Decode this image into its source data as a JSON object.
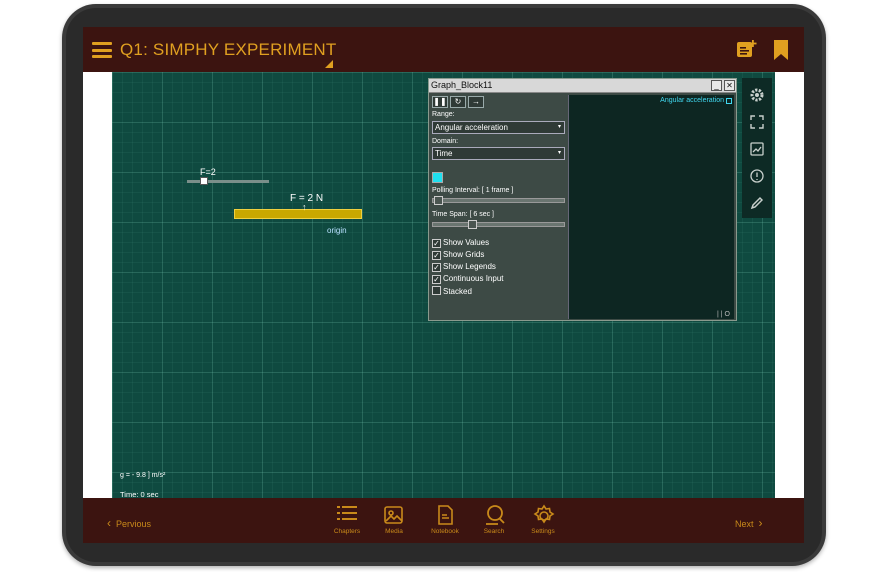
{
  "header": {
    "title": "Q1: SIMPHY EXPERIMENT"
  },
  "canvas": {
    "slider_label": "F=2",
    "force_label": "F = 2 N",
    "origin_label": "origin",
    "gravity_label": "g = - 9.8 ] m/s²",
    "time_label": "Time: 0 sec"
  },
  "graph_panel": {
    "title": "Graph_Block11",
    "range_label": "Range:",
    "range_value": "Angular acceleration",
    "domain_label": "Domain:",
    "domain_value": "Time",
    "series_color": "#20e0f0",
    "polling_label": "Polling Interval: [ 1 frame ]",
    "timespan_label": "Time Span: [ 6 sec ]",
    "checkboxes": [
      {
        "label": "Show Values",
        "checked": true
      },
      {
        "label": "Show Grids",
        "checked": true
      },
      {
        "label": "Show Legends",
        "checked": true
      },
      {
        "label": "Continuous Input",
        "checked": true
      },
      {
        "label": "Stacked",
        "checked": false
      }
    ],
    "legend": "Angular acceleration",
    "plot_footer": "| | O"
  },
  "bottom_bar": {
    "previous": "Pervious",
    "next": "Next",
    "chapters": "Chapters",
    "media": "Media",
    "notebook": "Notebook",
    "search": "Search",
    "settings": "Settings"
  },
  "colors": {
    "header_bg": "#3c1410",
    "accent": "#e0a020",
    "canvas_bg": "#0f4a40"
  }
}
